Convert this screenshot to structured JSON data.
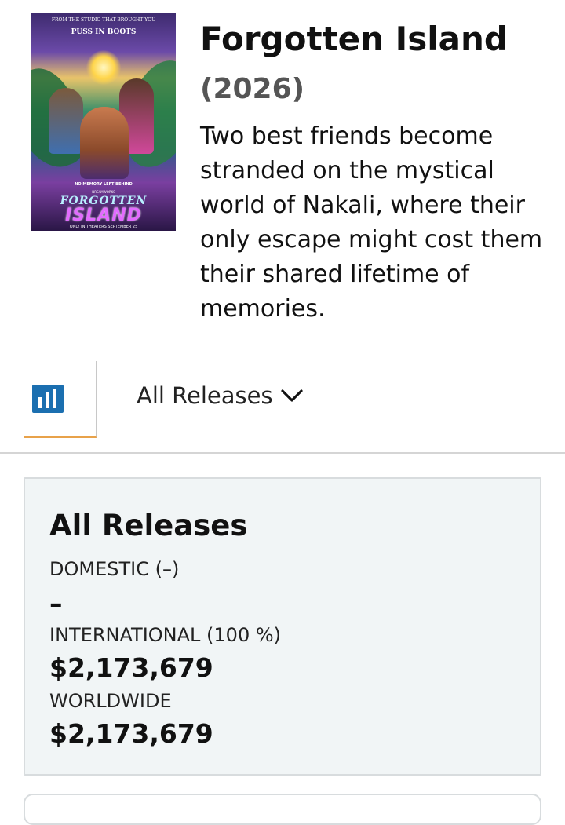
{
  "movie": {
    "title": "Forgotten Island",
    "year": "(2026)",
    "synopsis": "Two best friends become stranded on the mystical world of Nakali, where their only escape might cost them their shared lifetime of memories."
  },
  "poster": {
    "top_line": "FROM THE STUDIO THAT BROUGHT YOU",
    "top_brand": "PUSS IN BOOTS",
    "tagline": "NO MEMORY LEFT BEHIND",
    "studio": "DREAMWORKS",
    "title_line1": "FORGOTTEN",
    "title_line2": "ISLAND",
    "release_line": "ONLY IN THEATERS SEPTEMBER 25"
  },
  "release_selector": {
    "label": "All Releases"
  },
  "summary": {
    "title": "All Releases",
    "domestic_label": "DOMESTIC (–)",
    "domestic_value": "–",
    "international_label": "INTERNATIONAL (100 %)",
    "international_value": "$2,173,679",
    "worldwide_label": "WORLDWIDE",
    "worldwide_value": "$2,173,679"
  },
  "icons": {
    "chart_tab": "bar-chart-icon",
    "dropdown": "chevron-down-icon"
  },
  "colors": {
    "accent_tab": "#e8a24a",
    "chart_icon": "#1b6fb0",
    "card_bg": "#f1f5f6"
  }
}
